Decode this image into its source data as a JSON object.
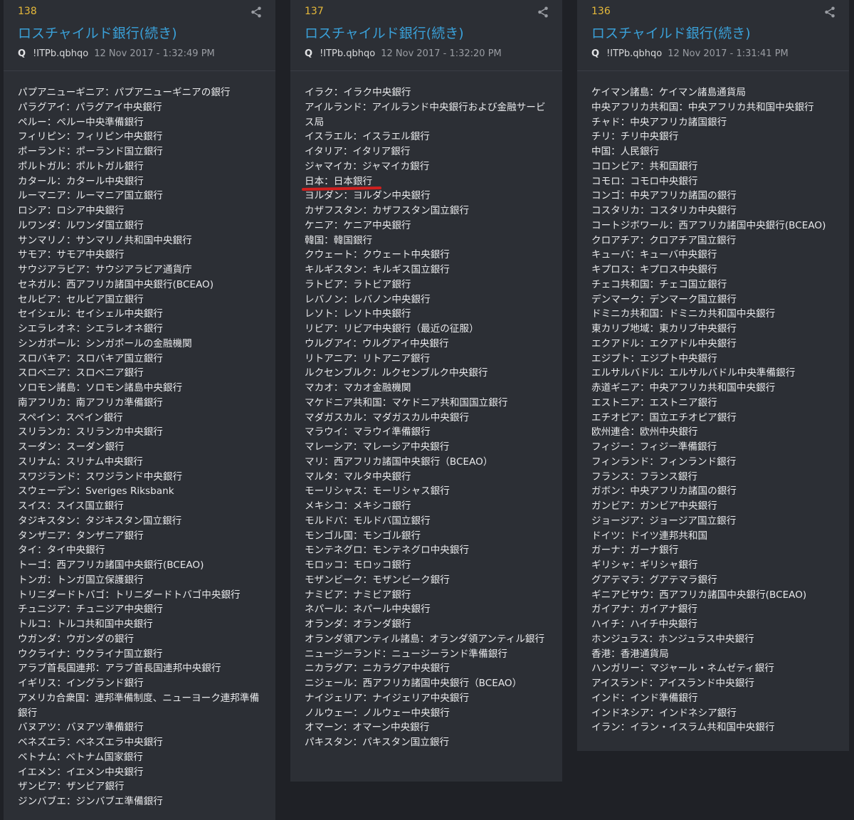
{
  "posts": [
    {
      "number": "138",
      "title": "ロスチャイルド銀行(続き)",
      "q": "Q",
      "tripcode": "!ITPb.qbhqo",
      "date": "12 Nov 2017 - 1:32:49 PM",
      "lines": [
        "パプアニューギニア：パプアニューギニアの銀行",
        "パラグアイ：パラグアイ中央銀行",
        "ペルー：ペルー中央準備銀行",
        "フィリピン：フィリピン中央銀行",
        "ポーランド：ポーランド国立銀行",
        "ポルトガル：ポルトガル銀行",
        "カタール：カタール中央銀行",
        "ルーマニア：ルーマニア国立銀行",
        "ロシア：ロシア中央銀行",
        "ルワンダ：ルワンダ国立銀行",
        "サンマリノ：サンマリノ共和国中央銀行",
        "サモア：サモア中央銀行",
        "サウジアラビア：サウジアラビア通貨庁",
        "セネガル：西アフリカ諸国中央銀行(BCEAO)",
        "セルビア：セルビア国立銀行",
        "セイシェル：セイシェル中央銀行",
        "シエラレオネ：シエラレオネ銀行",
        "シンガポール：シンガポールの金融機関",
        "スロバキア：スロバキア国立銀行",
        "スロベニア：スロベニア銀行",
        "ソロモン諸島：ソロモン諸島中央銀行",
        "南アフリカ：南アフリカ準備銀行",
        "スペイン：スペイン銀行",
        "スリランカ：スリランカ中央銀行",
        "スーダン：スーダン銀行",
        "スリナム：スリナム中央銀行",
        "スワジランド：スワジランド中央銀行",
        "スウェーデン：Sveriges Riksbank",
        "スイス：スイス国立銀行",
        "タジキスタン：タジキスタン国立銀行",
        "タンザニア：タンザニア銀行",
        "タイ：タイ中央銀行",
        "トーゴ：西アフリカ諸国中央銀行(BCEAO)",
        "トンガ：トンガ国立保護銀行",
        "トリニダードトバゴ：トリニダードトバゴ中央銀行",
        "チュニジア：チュニジア中央銀行",
        "トルコ：トルコ共和国中央銀行",
        "ウガンダ：ウガンダの銀行",
        "ウクライナ：ウクライナ国立銀行",
        "アラブ首長国連邦：アラブ首長国連邦中央銀行",
        "イギリス：イングランド銀行",
        "アメリカ合衆国：連邦準備制度、ニューヨーク連邦準備銀行",
        "バヌアツ：バヌアツ準備銀行",
        "ベネズエラ：ベネズエラ中央銀行",
        "ベトナム：ベトナム国家銀行",
        "イエメン：イエメン中央銀行",
        "ザンビア：ザンビア銀行",
        "ジンバブエ：ジンバブエ準備銀行"
      ]
    },
    {
      "number": "137",
      "title": "ロスチャイルド銀行(続き)",
      "q": "Q",
      "tripcode": "!ITPb.qbhqo",
      "date": "12 Nov 2017 - 1:32:20 PM",
      "lines": [
        "イラク：イラク中央銀行",
        "アイルランド：アイルランド中央銀行および金融サービス局",
        "イスラエル：イスラエル銀行",
        "イタリア：イタリア銀行",
        "ジャマイカ：ジャマイカ銀行",
        "日本：日本銀行",
        "ヨルダン：ヨルダン中央銀行",
        "カザフスタン：カザフスタン国立銀行",
        "ケニア：ケニア中央銀行",
        "韓国：韓国銀行",
        "クウェート：クウェート中央銀行",
        "キルギスタン：キルギス国立銀行",
        "ラトビア：ラトビア銀行",
        "レバノン：レバノン中央銀行",
        "レソト：レソト中央銀行",
        "リビア：リビア中央銀行（最近の征服）",
        "ウルグアイ：ウルグアイ中央銀行",
        "リトアニア：リトアニア銀行",
        "ルクセンブルク：ルクセンブルク中央銀行",
        "マカオ：マカオ金融機関",
        "マケドニア共和国：マケドニア共和国国立銀行",
        "マダガスカル：マダガスカル中央銀行",
        "マラウイ：マラウイ準備銀行",
        "マレーシア：マレーシア中央銀行",
        "マリ：西アフリカ諸国中央銀行（BCEAO）",
        "マルタ：マルタ中央銀行",
        "モーリシャス：モーリシャス銀行",
        "メキシコ：メキシコ銀行",
        "モルドバ：モルドバ国立銀行",
        "モンゴル国：モンゴル銀行",
        "モンテネグロ：モンテネグロ中央銀行",
        "モロッコ：モロッコ銀行",
        "モザンビーク：モザンビーク銀行",
        "ナミビア：ナミビア銀行",
        "ネパール：ネパール中央銀行",
        "オランダ：オランダ銀行",
        "オランダ領アンティル諸島：オランダ領アンティル銀行",
        "ニュージーランド：ニュージーランド準備銀行",
        "ニカラグア：ニカラグア中央銀行",
        "ニジェール：西アフリカ諸国中央銀行（BCEAO）",
        "ナイジェリア：ナイジェリア中央銀行",
        "ノルウェー：ノルウェー中央銀行",
        "オマーン：オマーン中央銀行",
        "パキスタン：パキスタン国立銀行"
      ]
    },
    {
      "number": "136",
      "title": "ロスチャイルド銀行(続き)",
      "q": "Q",
      "tripcode": "!ITPb.qbhqo",
      "date": "12 Nov 2017 - 1:31:41 PM",
      "lines": [
        "ケイマン諸島：ケイマン諸島通貨局",
        "中央アフリカ共和国：中央アフリカ共和国中央銀行",
        "チャド：中央アフリカ諸国銀行",
        "チリ：チリ中央銀行",
        "中国：人民銀行",
        "コロンビア：共和国銀行",
        "コモロ：コモロ中央銀行",
        "コンゴ：中央アフリカ諸国の銀行",
        "コスタリカ：コスタリカ中央銀行",
        "コートジボワール：西アフリカ諸国中央銀行(BCEAO)",
        "クロアチア：クロアチア国立銀行",
        "キューバ：キューバ中央銀行",
        "キプロス：キプロス中央銀行",
        "チェコ共和国：チェコ国立銀行",
        "デンマーク：デンマーク国立銀行",
        "ドミニカ共和国：ドミニカ共和国中央銀行",
        "東カリブ地域：東カリブ中央銀行",
        "エクアドル：エクアドル中央銀行",
        "エジプト：エジプト中央銀行",
        "エルサルバドル：エルサルバドル中央準備銀行",
        "赤道ギニア：中央アフリカ共和国中央銀行",
        "エストニア：エストニア銀行",
        "エチオピア：国立エチオピア銀行",
        "欧州連合：欧州中央銀行",
        "フィジー：フィジー準備銀行",
        "フィンランド：フィンランド銀行",
        "フランス：フランス銀行",
        "ガボン：中央アフリカ諸国の銀行",
        "ガンビア：ガンビア中央銀行",
        "ジョージア：ジョージア国立銀行",
        "ドイツ：ドイツ連邦共和国",
        "ガーナ：ガーナ銀行",
        "ギリシャ：ギリシャ銀行",
        "グアテマラ：グアテマラ銀行",
        "ギニアビサウ：西アフリカ諸国中央銀行(BCEAO)",
        "ガイアナ：ガイアナ銀行",
        "ハイチ：ハイチ中央銀行",
        "ホンジュラス：ホンジュラス中央銀行",
        "香港：香港通貨局",
        "ハンガリー：マジャール・ネムゼティ銀行",
        "アイスランド：アイスランド中央銀行",
        "インド：インド準備銀行",
        "インドネシア：インドネシア銀行",
        "イラン：イラン・イスラム共和国中央銀行"
      ]
    }
  ],
  "colors": {
    "background": "#1f2126",
    "card": "#2c2f35",
    "post_number": "#e6b93a",
    "title_link": "#3aa0d8",
    "text": "#e8e9eb",
    "underline_mark": "#d0201f"
  },
  "icons": {
    "share": "share-icon"
  }
}
